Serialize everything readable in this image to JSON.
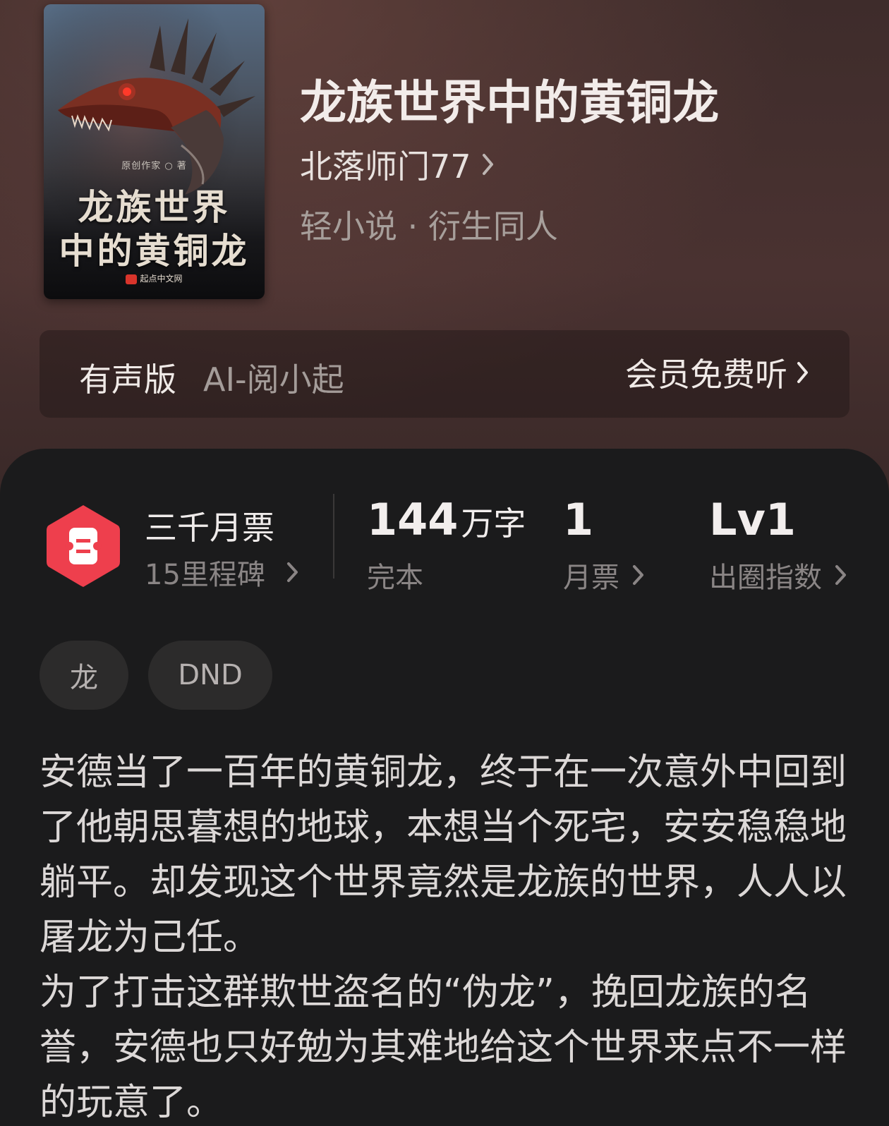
{
  "book": {
    "title": "龙族世界中的黄铜龙",
    "author": "北落师门77",
    "genre": "轻小说 · 衍生同人"
  },
  "cover": {
    "author_line": "原创作家 ○ 著",
    "title_line1": "龙族世界",
    "title_line2": "中的黄铜龙",
    "publisher": "起点中文网"
  },
  "audio": {
    "label": "有声版",
    "narrator": "AI-阅小起",
    "cta": "会员免费听"
  },
  "badge": {
    "title": "三千月票",
    "subtitle": "15里程碑",
    "icon": "ticket-icon",
    "color": "#ee3f4d"
  },
  "stats": {
    "words_value": "144",
    "words_unit": "万字",
    "words_label": "完本",
    "tickets_value": "1",
    "tickets_label": "月票",
    "level_value": "Lv1",
    "level_label": "出圈指数"
  },
  "tags": [
    "龙",
    "DND"
  ],
  "synopsis": {
    "para1": "安德当了一百年的黄铜龙，终于在一次意外中回到了他朝思暮想的地球，本想当个死宅，安安稳稳地躺平。却发现这个世界竟然是龙族的世界，人人以屠龙为己任。",
    "para2": "为了打击这群欺世盗名的“伪龙”，挽回龙族的名誉，安德也只好勉为其难地给这个世界来点不一样的玩意了。"
  }
}
